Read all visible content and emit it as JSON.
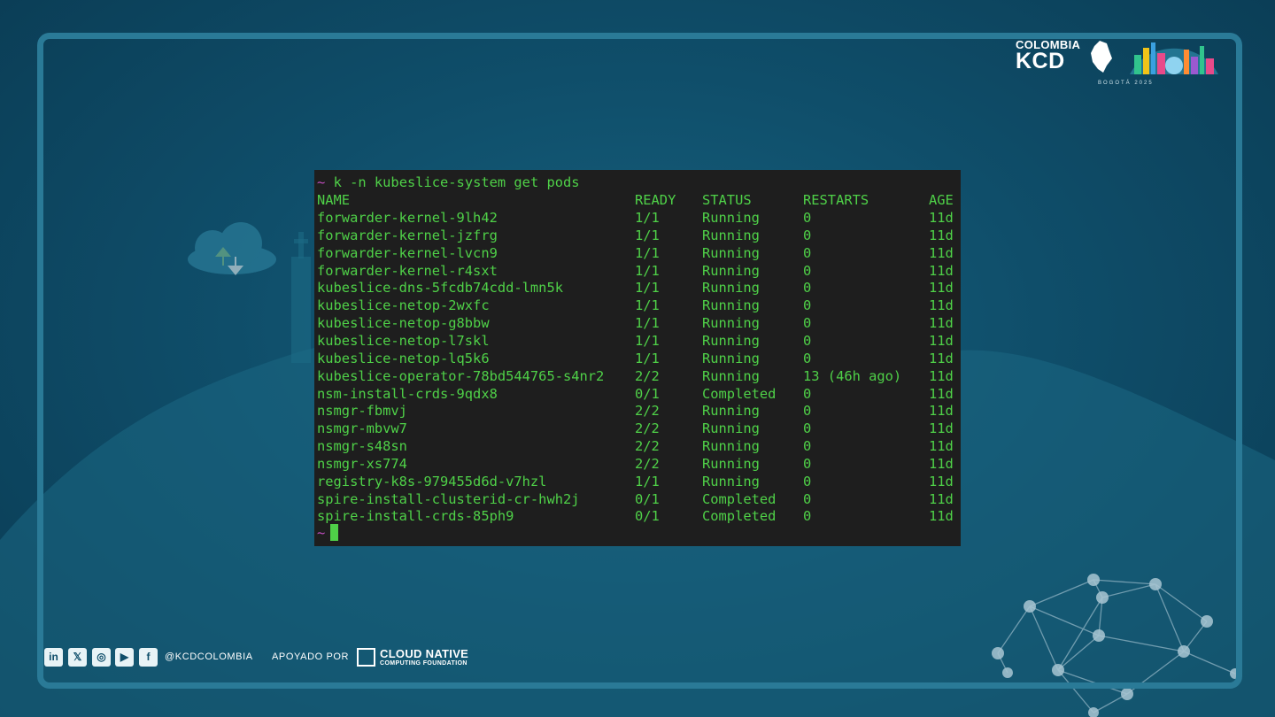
{
  "terminal": {
    "prompt_symbol": "~",
    "command": "k -n kubeslice-system get pods",
    "headers": {
      "name": "NAME",
      "ready": "READY",
      "status": "STATUS",
      "restarts": "RESTARTS",
      "age": "AGE"
    },
    "rows": [
      {
        "name": "forwarder-kernel-9lh42",
        "ready": "1/1",
        "status": "Running",
        "restarts": "0",
        "age": "11d"
      },
      {
        "name": "forwarder-kernel-jzfrg",
        "ready": "1/1",
        "status": "Running",
        "restarts": "0",
        "age": "11d"
      },
      {
        "name": "forwarder-kernel-lvcn9",
        "ready": "1/1",
        "status": "Running",
        "restarts": "0",
        "age": "11d"
      },
      {
        "name": "forwarder-kernel-r4sxt",
        "ready": "1/1",
        "status": "Running",
        "restarts": "0",
        "age": "11d"
      },
      {
        "name": "kubeslice-dns-5fcdb74cdd-lmn5k",
        "ready": "1/1",
        "status": "Running",
        "restarts": "0",
        "age": "11d"
      },
      {
        "name": "kubeslice-netop-2wxfc",
        "ready": "1/1",
        "status": "Running",
        "restarts": "0",
        "age": "11d"
      },
      {
        "name": "kubeslice-netop-g8bbw",
        "ready": "1/1",
        "status": "Running",
        "restarts": "0",
        "age": "11d"
      },
      {
        "name": "kubeslice-netop-l7skl",
        "ready": "1/1",
        "status": "Running",
        "restarts": "0",
        "age": "11d"
      },
      {
        "name": "kubeslice-netop-lq5k6",
        "ready": "1/1",
        "status": "Running",
        "restarts": "0",
        "age": "11d"
      },
      {
        "name": "kubeslice-operator-78bd544765-s4nr2",
        "ready": "2/2",
        "status": "Running",
        "restarts": "13 (46h ago)",
        "age": "11d"
      },
      {
        "name": "nsm-install-crds-9qdx8",
        "ready": "0/1",
        "status": "Completed",
        "restarts": "0",
        "age": "11d"
      },
      {
        "name": "nsmgr-fbmvj",
        "ready": "2/2",
        "status": "Running",
        "restarts": "0",
        "age": "11d"
      },
      {
        "name": "nsmgr-mbvw7",
        "ready": "2/2",
        "status": "Running",
        "restarts": "0",
        "age": "11d"
      },
      {
        "name": "nsmgr-s48sn",
        "ready": "2/2",
        "status": "Running",
        "restarts": "0",
        "age": "11d"
      },
      {
        "name": "nsmgr-xs774",
        "ready": "2/2",
        "status": "Running",
        "restarts": "0",
        "age": "11d"
      },
      {
        "name": "registry-k8s-979455d6d-v7hzl",
        "ready": "1/1",
        "status": "Running",
        "restarts": "0",
        "age": "11d"
      },
      {
        "name": "spire-install-clusterid-cr-hwh2j",
        "ready": "0/1",
        "status": "Completed",
        "restarts": "0",
        "age": "11d"
      },
      {
        "name": "spire-install-crds-85ph9",
        "ready": "0/1",
        "status": "Completed",
        "restarts": "0",
        "age": "11d"
      }
    ],
    "colors": {
      "text": "#4fd148",
      "prompt": "#c24dbf",
      "background": "#1e1e1e"
    }
  },
  "branding": {
    "logo_line1": "COLOMBIA",
    "logo_line2": "KCD",
    "logo_sub": "BOGOTÁ 2025",
    "handle": "@KCDCOLOMBIA",
    "supported_by": "APOYADO POR",
    "cncf_line1": "CLOUD NATIVE",
    "cncf_line2": "COMPUTING FOUNDATION",
    "social_icons": [
      "linkedin-icon",
      "x-icon",
      "instagram-icon",
      "youtube-icon",
      "facebook-icon"
    ],
    "social_glyphs": [
      "in",
      "𝕏",
      "◎",
      "▶",
      "f"
    ]
  },
  "theme": {
    "frame": "#2a7a97",
    "background": "#0f4e6a"
  }
}
